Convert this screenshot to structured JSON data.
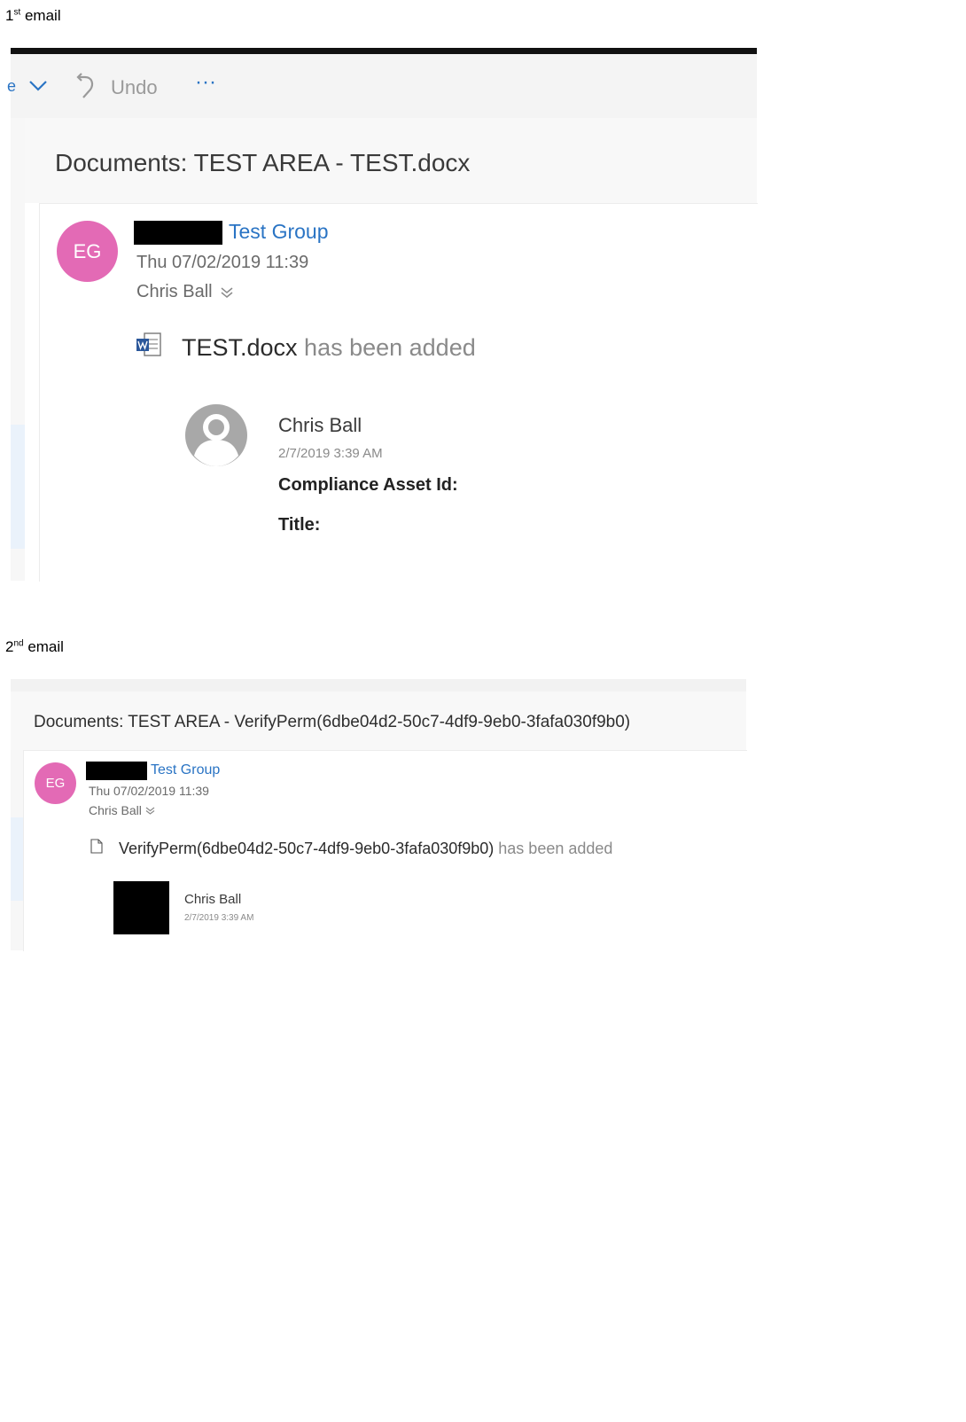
{
  "captions": {
    "first": {
      "num": "1",
      "suffix": "st",
      "text": " email"
    },
    "second": {
      "num": "2",
      "suffix": "nd",
      "text": " email"
    }
  },
  "email1": {
    "toolbar": {
      "partial": "e",
      "undo_label": "Undo",
      "more_label": "···"
    },
    "subject": "Documents: TEST AREA - TEST.docx",
    "avatar_initials": "EG",
    "group": "Test Group",
    "date": "Thu 07/02/2019 11:39",
    "to": "Chris Ball",
    "file_name": "TEST.docx",
    "added_text": " has been added",
    "person_name": "Chris Ball",
    "person_date": "2/7/2019 3:39 AM",
    "field1": "Compliance Asset Id:",
    "field2": "Title:"
  },
  "email2": {
    "subject": "Documents: TEST AREA - VerifyPerm(6dbe04d2-50c7-4df9-9eb0-3fafa030f9b0)",
    "avatar_initials": "EG",
    "group": "Test Group",
    "date": "Thu 07/02/2019 11:39",
    "to": "Chris Ball",
    "file_name": "VerifyPerm(6dbe04d2-50c7-4df9-9eb0-3fafa030f9b0)",
    "added_text": " has been added",
    "person_name": "Chris Ball",
    "person_date": "2/7/2019 3:39 AM"
  },
  "colors": {
    "avatar": "#e36ab5",
    "link": "#2a74c4"
  }
}
